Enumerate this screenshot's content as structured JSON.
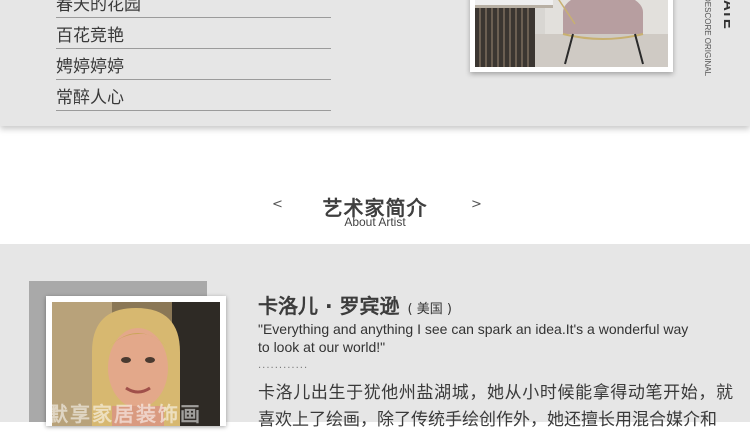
{
  "menu": {
    "items": [
      {
        "label": "春天的花园"
      },
      {
        "label": "百花竞艳"
      },
      {
        "label": "娉婷婷婷"
      },
      {
        "label": "常醉人心"
      }
    ]
  },
  "brand": {
    "vertical_text": "ATE",
    "vertical_sub": "DESCORE ORIGINAL"
  },
  "section": {
    "title": "艺术家简介",
    "subtitle": "About Artist",
    "prev_arrow": "<",
    "next_arrow": ">"
  },
  "artist": {
    "name": "卡洛儿 · 罗宾逊",
    "country": "( 美国 )",
    "quote": "\"Everything and anything I see can spark an idea.It's a wonderful way to look at our world!\"",
    "divider": "............",
    "bio": "卡洛儿出生于犹他州盐湖城，她从小时候能拿得动笔开始，就喜欢上了绘画，除了传统手绘创作外，她还擅长用混合媒介和",
    "watermark": "默享家居装饰画"
  },
  "colors": {
    "band_bg": "#e6e6e6",
    "text_dark": "#3a3a3a"
  }
}
